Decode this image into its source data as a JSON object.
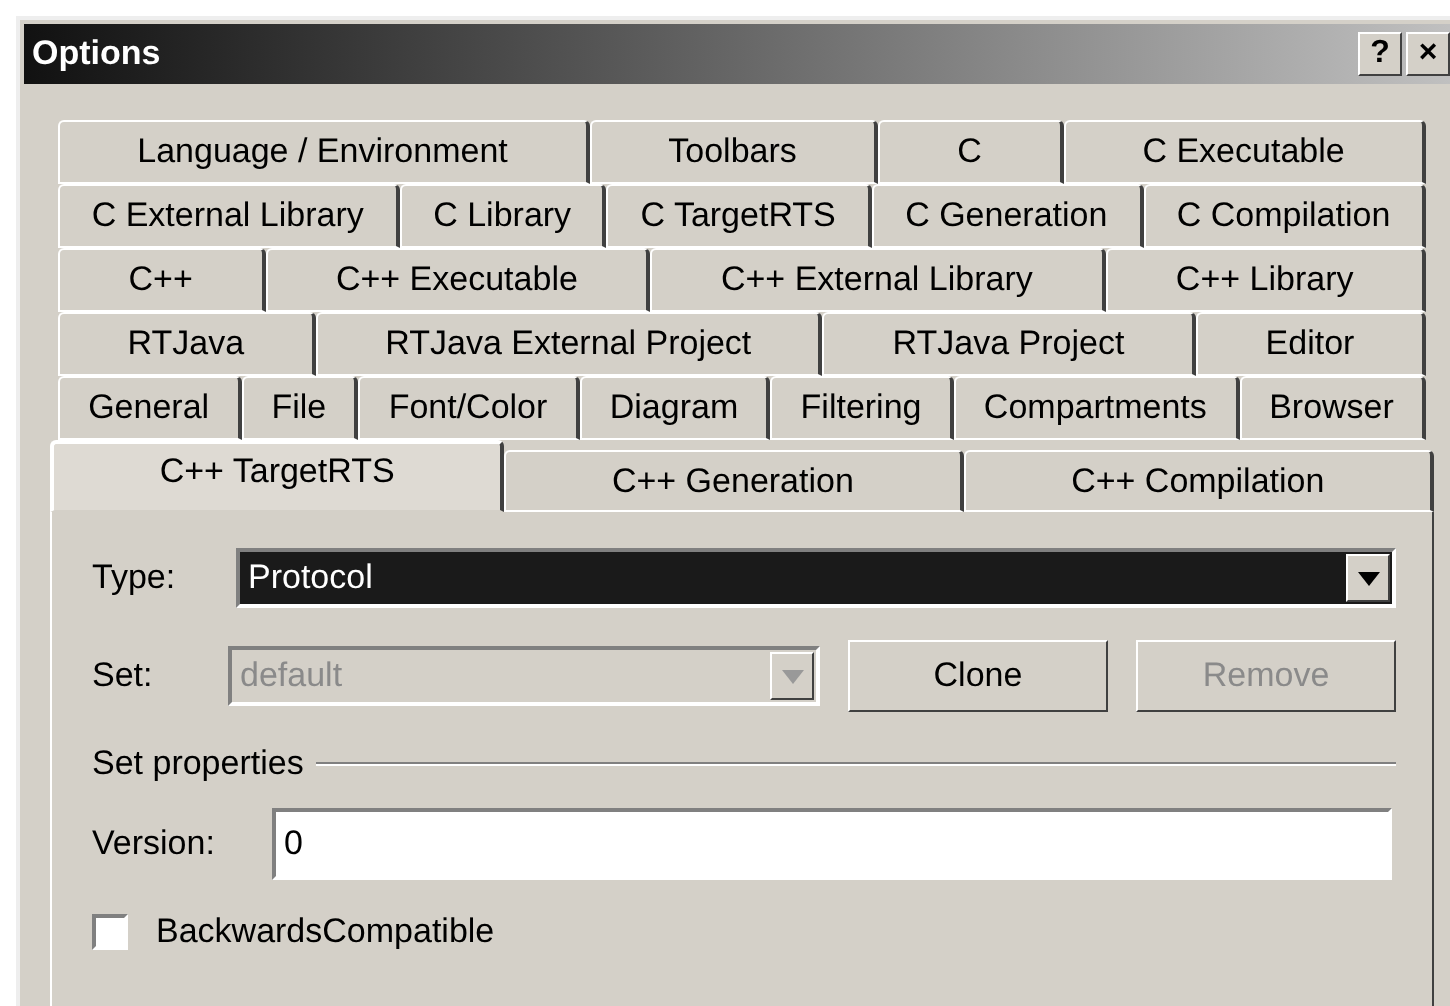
{
  "window": {
    "title": "Options",
    "help_button": "?",
    "close_button": "×"
  },
  "tab_rows": [
    {
      "tabs": [
        {
          "label": "Language / Environment",
          "selected": false
        },
        {
          "label": "Toolbars",
          "selected": false
        },
        {
          "label": "C",
          "selected": false
        },
        {
          "label": "C Executable",
          "selected": false
        }
      ]
    },
    {
      "tabs": [
        {
          "label": "C External Library",
          "selected": false
        },
        {
          "label": "C Library",
          "selected": false
        },
        {
          "label": "C TargetRTS",
          "selected": false
        },
        {
          "label": "C Generation",
          "selected": false
        },
        {
          "label": "C Compilation",
          "selected": false
        }
      ]
    },
    {
      "tabs": [
        {
          "label": "C++",
          "selected": false
        },
        {
          "label": "C++ Executable",
          "selected": false
        },
        {
          "label": "C++ External Library",
          "selected": false
        },
        {
          "label": "C++ Library",
          "selected": false
        }
      ]
    },
    {
      "tabs": [
        {
          "label": "RTJava",
          "selected": false
        },
        {
          "label": "RTJava External Project",
          "selected": false
        },
        {
          "label": "RTJava Project",
          "selected": false
        },
        {
          "label": "Editor",
          "selected": false
        }
      ]
    },
    {
      "tabs": [
        {
          "label": "General",
          "selected": false
        },
        {
          "label": "File",
          "selected": false
        },
        {
          "label": "Font/Color",
          "selected": false
        },
        {
          "label": "Diagram",
          "selected": false
        },
        {
          "label": "Filtering",
          "selected": false
        },
        {
          "label": "Compartments",
          "selected": false
        },
        {
          "label": "Browser",
          "selected": false
        }
      ]
    },
    {
      "tabs": [
        {
          "label": "C++ TargetRTS",
          "selected": true
        },
        {
          "label": "C++ Generation",
          "selected": false
        },
        {
          "label": "C++ Compilation",
          "selected": false
        }
      ]
    }
  ],
  "type_field": {
    "label": "Type:",
    "value": "Protocol",
    "disabled": false
  },
  "set_field": {
    "label": "Set:",
    "value": "default",
    "disabled": true
  },
  "buttons": [
    {
      "label": "Clone",
      "disabled": false
    },
    {
      "label": "Remove",
      "disabled": true
    }
  ],
  "group": {
    "title": "Set properties"
  },
  "version_field": {
    "label": "Version:",
    "value": "0"
  },
  "checkbox": {
    "label": "BackwardsCompatible",
    "checked": false
  }
}
